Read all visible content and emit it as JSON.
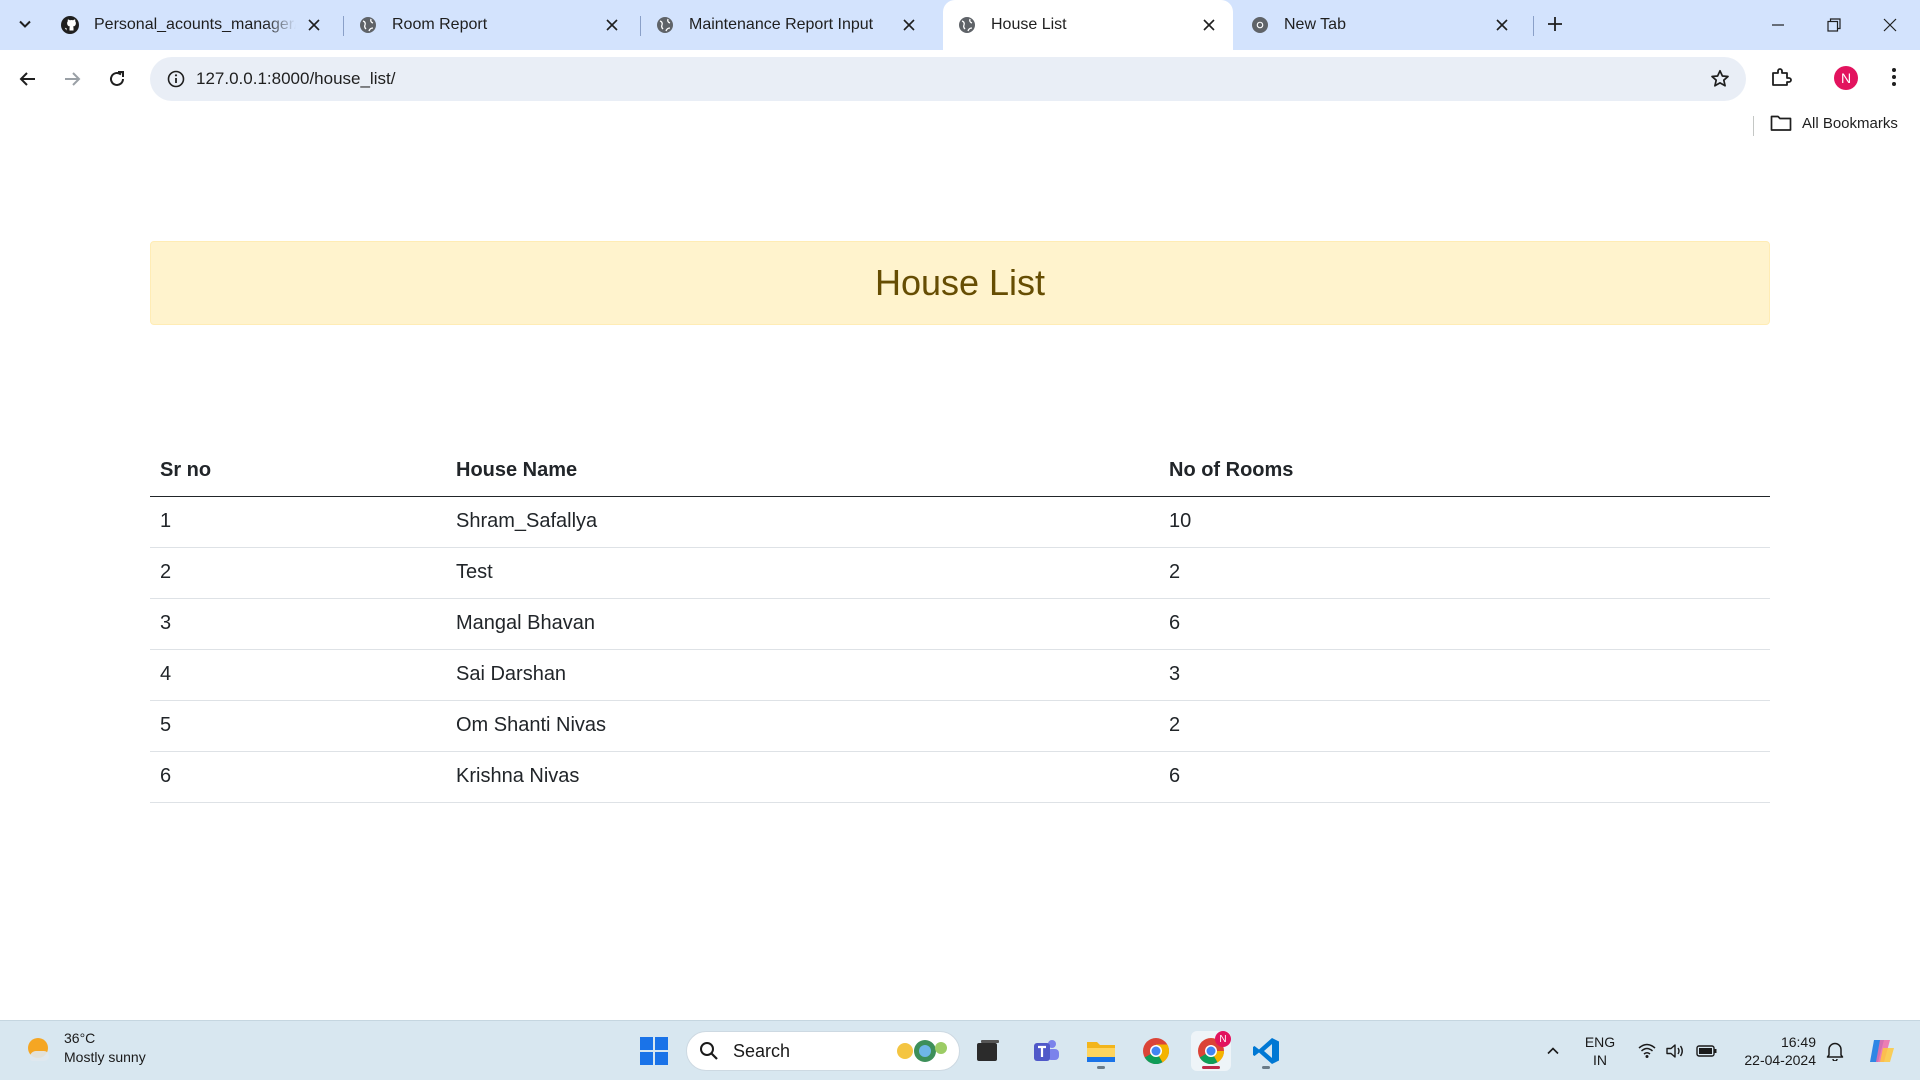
{
  "browser": {
    "tabs": [
      {
        "title": "Personal_acounts_manager/ap",
        "favicon": "github-icon",
        "active": false
      },
      {
        "title": "Room Report",
        "favicon": "globe-icon",
        "active": false
      },
      {
        "title": "Maintenance Report Input",
        "favicon": "globe-icon",
        "active": false
      },
      {
        "title": "House List",
        "favicon": "globe-icon",
        "active": true
      },
      {
        "title": "New Tab",
        "favicon": "chrome-icon",
        "active": false
      }
    ],
    "url": "127.0.0.1:8000/house_list/",
    "profile_initial": "N",
    "bookmarks_label": "All Bookmarks"
  },
  "page": {
    "heading": "House List",
    "table": {
      "columns": [
        "Sr no",
        "House Name",
        "No of Rooms"
      ],
      "rows": [
        {
          "sr": "1",
          "name": "Shram_Safallya",
          "rooms": "10"
        },
        {
          "sr": "2",
          "name": "Test",
          "rooms": "2"
        },
        {
          "sr": "3",
          "name": "Mangal Bhavan",
          "rooms": "6"
        },
        {
          "sr": "4",
          "name": "Sai Darshan",
          "rooms": "3"
        },
        {
          "sr": "5",
          "name": "Om Shanti Nivas",
          "rooms": "2"
        },
        {
          "sr": "6",
          "name": "Krishna Nivas",
          "rooms": "6"
        }
      ]
    }
  },
  "taskbar": {
    "weather": {
      "temp": "36°C",
      "condition": "Mostly sunny"
    },
    "search_label": "Search",
    "language": {
      "line1": "ENG",
      "line2": "IN"
    },
    "clock": {
      "time": "16:49",
      "date": "22-04-2024"
    },
    "chrome_badge": "N"
  },
  "colors": {
    "tabstrip_bg": "#d3e3fd",
    "banner_bg": "#fff3cd",
    "banner_text": "#664d03",
    "profile_bg": "#e2135e",
    "taskbar_bg": "#d8e7f0"
  }
}
